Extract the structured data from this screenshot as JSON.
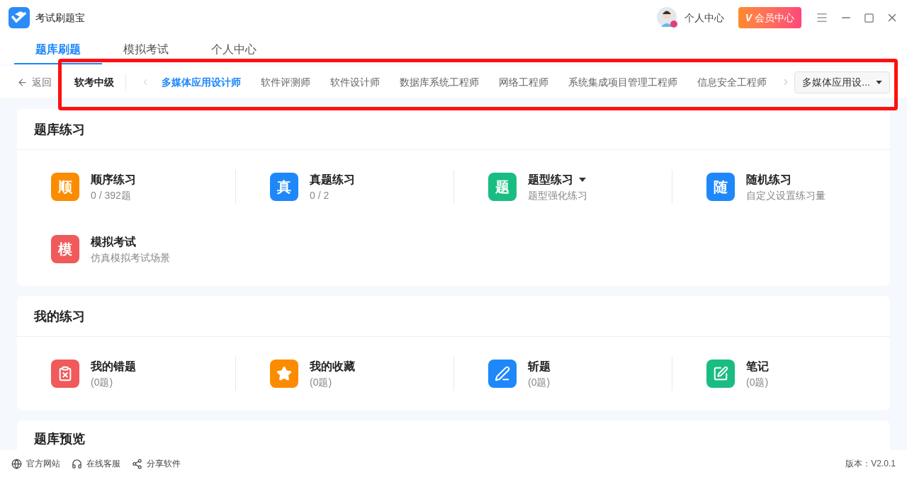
{
  "app": {
    "title": "考试刷题宝",
    "user_label": "个人中心",
    "vip_button": "会员中心",
    "vip_mark": "V"
  },
  "tabs": [
    {
      "label": "题库刷题",
      "selected": true
    },
    {
      "label": "模拟考试",
      "selected": false
    },
    {
      "label": "个人中心",
      "selected": false
    }
  ],
  "subject_bar": {
    "back": "返回",
    "level": "软考中级",
    "highlighted": true,
    "subjects": [
      {
        "label": "多媒体应用设计师",
        "selected": true
      },
      {
        "label": "软件评测师",
        "selected": false
      },
      {
        "label": "软件设计师",
        "selected": false
      },
      {
        "label": "数据库系统工程师",
        "selected": false
      },
      {
        "label": "网络工程师",
        "selected": false
      },
      {
        "label": "系统集成项目管理工程师",
        "selected": false
      },
      {
        "label": "信息安全工程师",
        "selected": false
      }
    ],
    "dropdown": "多媒体应用设..."
  },
  "sections": [
    {
      "title": "题库练习",
      "items": [
        {
          "kind": "letter",
          "glyph": "顺",
          "color": "#fb8c00",
          "title": "顺序练习",
          "subtitle": "0 / 392题",
          "dropdown": false
        },
        {
          "kind": "letter",
          "glyph": "真",
          "color": "#1e88fa",
          "title": "真题练习",
          "subtitle": "0 / 2",
          "dropdown": false
        },
        {
          "kind": "letter",
          "glyph": "题",
          "color": "#19bd82",
          "title": "题型练习",
          "subtitle": "题型强化练习",
          "dropdown": true
        },
        {
          "kind": "letter",
          "glyph": "随",
          "color": "#1e88fa",
          "title": "随机练习",
          "subtitle": "自定义设置练习量",
          "dropdown": false
        },
        {
          "kind": "letter",
          "glyph": "模",
          "color": "#f05a5a",
          "title": "模拟考试",
          "subtitle": "仿真模拟考试场景",
          "dropdown": false
        }
      ]
    },
    {
      "title": "我的练习",
      "items": [
        {
          "kind": "wrong",
          "color": "#f05a5a",
          "title": "我的错题",
          "subtitle": "(0题)",
          "dropdown": false
        },
        {
          "kind": "star",
          "color": "#fb8c00",
          "title": "我的收藏",
          "subtitle": "(0题)",
          "dropdown": false
        },
        {
          "kind": "slash",
          "color": "#1e88fa",
          "title": "斩题",
          "subtitle": "(0题)",
          "dropdown": false
        },
        {
          "kind": "note",
          "color": "#19bd82",
          "title": "笔记",
          "subtitle": "(0题)",
          "dropdown": false
        }
      ]
    },
    {
      "title": "题库预览"
    }
  ],
  "footer": {
    "links": [
      {
        "kind": "globe",
        "label": "官方网站"
      },
      {
        "kind": "headset",
        "label": "在线客服"
      },
      {
        "kind": "share",
        "label": "分享软件"
      }
    ],
    "version": "版本：V2.0.1"
  }
}
